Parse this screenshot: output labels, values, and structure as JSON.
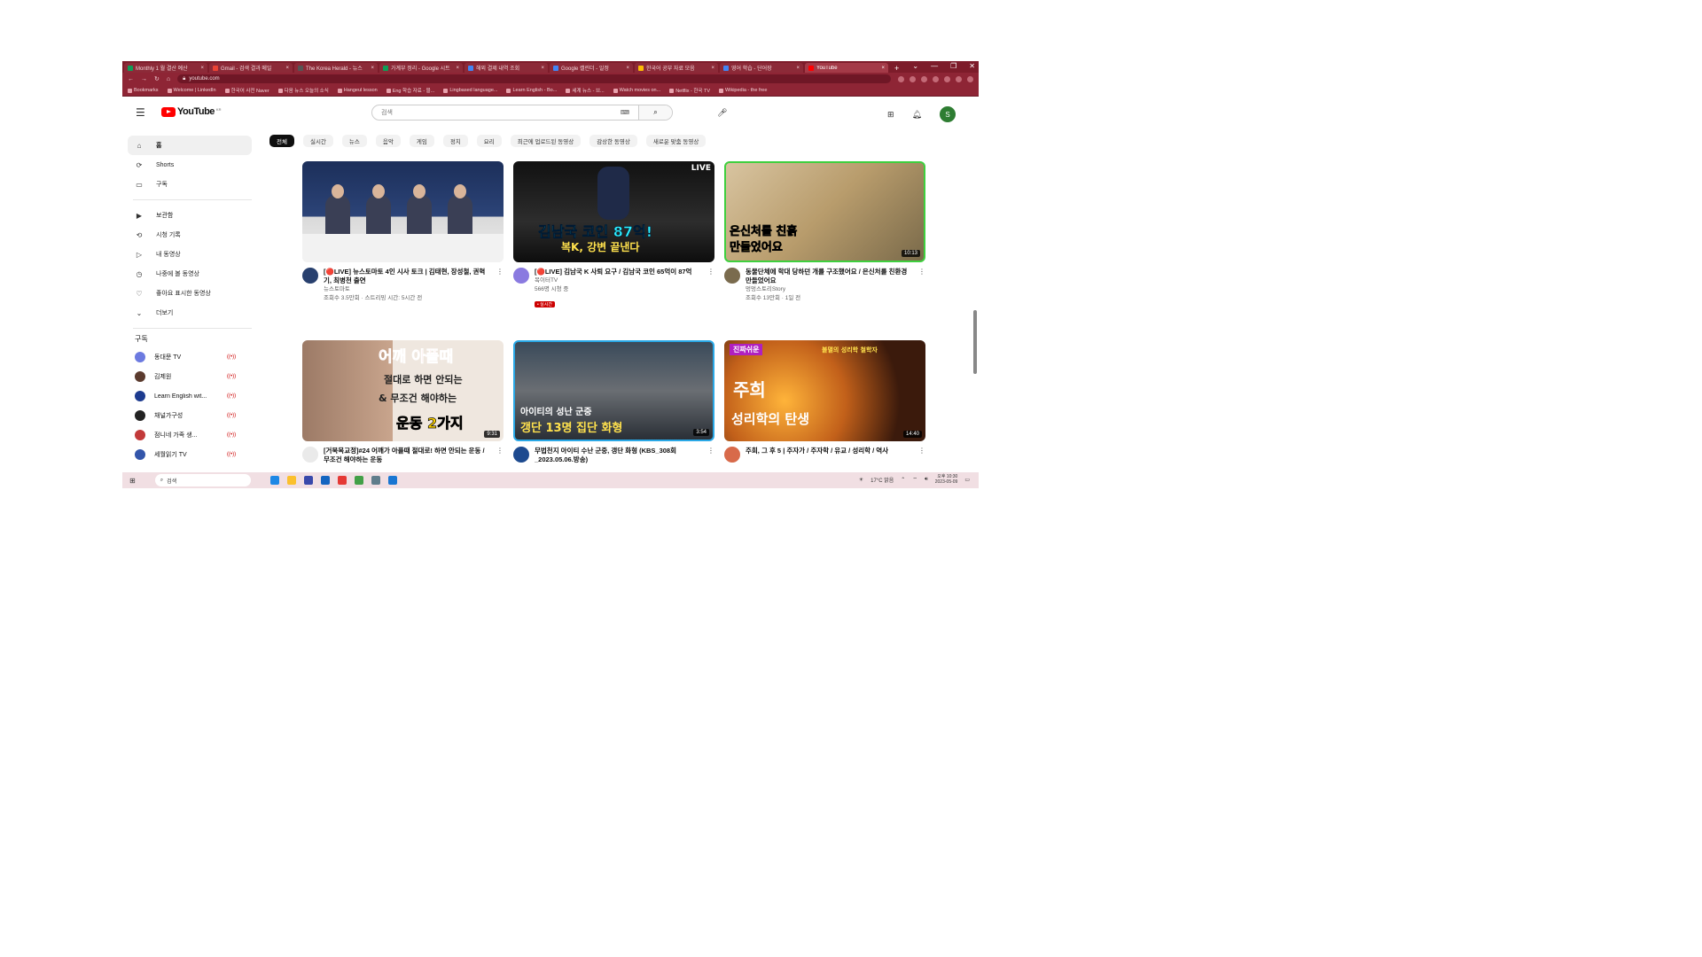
{
  "browser": {
    "tabs": [
      {
        "label": "Monthly 1 월 결산 예산",
        "color": "#0f9d58"
      },
      {
        "label": "Gmail - 검색 결과 메일",
        "color": "#ea4335"
      },
      {
        "label": "The Korea Herald - 뉴스",
        "color": "#555555"
      },
      {
        "label": "가계부 정리 - Google 시트",
        "color": "#0f9d58"
      },
      {
        "label": "해외 결제 내역 조회",
        "color": "#4285f4"
      },
      {
        "label": "Google 캘린더 - 일정",
        "color": "#4285f4"
      },
      {
        "label": "한국어 공부 자료 모음",
        "color": "#fbbc04"
      },
      {
        "label": "영어 학습 - 단어장",
        "color": "#4285f4"
      },
      {
        "label": "YouTube",
        "color": "#ff0000"
      }
    ],
    "new_tab": "+",
    "window_controls": [
      "⌄",
      "—",
      "❐",
      "✕"
    ],
    "url": "youtube.com",
    "bookmarks": [
      "Bookmarks",
      "Welcome | LinkedIn",
      "한국어 사전 Naver",
      "다음 뉴스 오늘의 소식",
      "Hangeul lesson",
      "Eng 학습 자료 - 블...",
      "Lingbased language...",
      "Learn English - Bo...",
      "세계 뉴스 - 브...",
      "Watch movies on...",
      "Netflix - 한국 TV",
      "Wikipedia - the free"
    ]
  },
  "youtube": {
    "logo_text": "YouTube",
    "logo_region": "KR",
    "search_placeholder": "검색",
    "keyboard_icon": "⌨",
    "avatar_letter": "S",
    "sidebar": {
      "main": [
        {
          "icon": "⌂",
          "label": "홈",
          "active": true
        },
        {
          "icon": "⟳",
          "label": "Shorts",
          "active": false
        },
        {
          "icon": "▭",
          "label": "구독",
          "active": false
        }
      ],
      "library": [
        {
          "icon": "▶",
          "label": "보관함"
        },
        {
          "icon": "⟲",
          "label": "시청 기록"
        },
        {
          "icon": "▷",
          "label": "내 동영상"
        },
        {
          "icon": "◷",
          "label": "나중에 볼 동영상"
        },
        {
          "icon": "♡",
          "label": "좋아요 표시한 동영상"
        },
        {
          "icon": "⌄",
          "label": "더보기"
        }
      ],
      "subscriptions_heading": "구독",
      "subscriptions": [
        {
          "name": "동대문 TV",
          "color": "#6c7ae0"
        },
        {
          "name": "김제원",
          "color": "#5b3b2e"
        },
        {
          "name": "Learn English wit...",
          "color": "#1d3b8f"
        },
        {
          "name": "채널가구성",
          "color": "#222222"
        },
        {
          "name": "점니네 가족 생...",
          "color": "#c23a3a"
        },
        {
          "name": "세월읽기 TV",
          "color": "#3355aa"
        }
      ]
    },
    "chips": [
      "전체",
      "실시간",
      "뉴스",
      "음악",
      "게임",
      "정치",
      "요리",
      "최근에 업로드된 동영상",
      "감상한 동영상",
      "새로운 맞춤 동영상"
    ],
    "videos": [
      {
        "title": "[🔴LIVE] 뉴스토마토 4인 시사 토크 | 김태현, 장성철, 권혁기, 최병천 출연",
        "channel": "뉴스토마토",
        "stats": "조회수 3.5만회 · 스트리밍 시간: 5시간 전",
        "duration": "",
        "kind": "studio",
        "avatar": "#28406e",
        "is_live": false
      },
      {
        "title": "[🔴LIVE] 김남국 K 사퇴 요구 / 김남국 코인 65억이 87억",
        "channel": "목이터TV",
        "stats": "566명 시청 중",
        "duration": "",
        "kind": "live",
        "avatar": "#8a7ae0",
        "is_live": true,
        "live_badge": "• 실시간",
        "overlay1": "김남국 코인 87억!",
        "overlay2": "복K, 강변 끝낸다",
        "corner": "LIVE"
      },
      {
        "title": "동물단체에 학대 당하던 개를 구조했어요 / 은신처를 친환경 만들었어요",
        "channel": "멍멍스토리Story",
        "stats": "조회수 13만회 · 1일 전",
        "duration": "10:13",
        "kind": "dog",
        "avatar": "#7a6b4e",
        "is_live": false,
        "overlay1": "은신처를 친흙",
        "overlay2": "만들었어요"
      },
      {
        "title": "[거북목교정]#24 어깨가 아플때 절대로! 하면 안되는 운동 / 무조건 해야하는 운동",
        "channel": "",
        "stats": "",
        "duration": "9:31",
        "kind": "shoulder",
        "avatar": "#eaeaea",
        "is_live": false,
        "overlay1": "어깨 아플때",
        "overlay2": "절대로 하면 안되는",
        "overlay3": "& 무조건 해야하는",
        "overlay4": "운동 2가지"
      },
      {
        "title": "무법천지 아이티 수난 군중, 갱단 화형 (KBS_308회_2023.05.06.방송)",
        "channel": "",
        "stats": "",
        "duration": "3:54",
        "kind": "haiti",
        "avatar": "#1d4a8f",
        "is_live": false,
        "overlay1": "아이티의 성난 군중",
        "overlay2": "갱단 13명 집단 화형"
      },
      {
        "title": "주희, 그 후 5 | 주자가 / 주자학 / 유교 / 성리학 / 역사",
        "channel": "",
        "stats": "",
        "duration": "14:40",
        "kind": "zhuxi",
        "avatar": "#d86a4a",
        "is_live": false,
        "tag": "진짜쉬운",
        "overlay1": "주희",
        "overlay2": "성리학의 탄생",
        "overlay_top": "불멸의 성리학 철학자"
      }
    ]
  },
  "taskbar": {
    "search_placeholder": "검색",
    "weather": "17°C 맑음",
    "clock_time": "오후 10:30",
    "clock_date": "2023-05-09",
    "apps": [
      "#1e88e5",
      "#fbc02d",
      "#3949ab",
      "#1565c0",
      "#e53935",
      "#43a047",
      "#607d8b",
      "#1976d2"
    ]
  }
}
